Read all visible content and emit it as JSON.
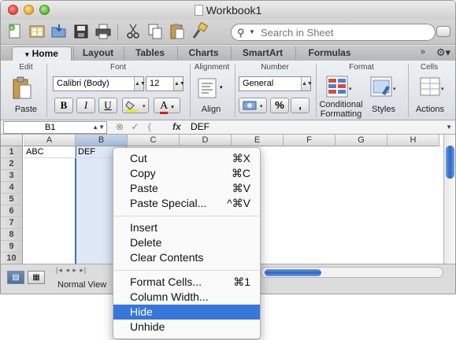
{
  "window": {
    "title": "Workbook1"
  },
  "toolbar": {
    "search_placeholder": "Search in Sheet"
  },
  "tabs": [
    "Home",
    "Layout",
    "Tables",
    "Charts",
    "SmartArt",
    "Formulas"
  ],
  "ribbon": {
    "groups": {
      "edit": "Edit",
      "font": "Font",
      "alignment": "Alignment",
      "number": "Number",
      "format": "Format",
      "cells": "Cells"
    },
    "paste_label": "Paste",
    "font_name": "Calibri (Body)",
    "font_size": "12",
    "bold": "B",
    "italic": "I",
    "underline": "U",
    "font_color_glyph": "A",
    "align_label": "Align",
    "number_format": "General",
    "percent": "%",
    "comma": ",",
    "conditional_formatting": [
      "Conditional",
      "Formatting"
    ],
    "styles_label": "Styles",
    "actions_label": "Actions"
  },
  "formula_bar": {
    "name_box": "B1",
    "fx": "fx",
    "content": "DEF"
  },
  "grid": {
    "columns": [
      "A",
      "B",
      "C",
      "D",
      "E",
      "F",
      "G",
      "H"
    ],
    "rows": [
      "1",
      "2",
      "3",
      "4",
      "5",
      "6",
      "7",
      "8",
      "9",
      "10"
    ],
    "cells": {
      "A1": "ABC",
      "B1": "DEF"
    }
  },
  "bottom": {
    "view_label": "Normal View",
    "sheet_nav": "|◂ ◂ ▸ ▸|"
  },
  "context_menu": {
    "groups": [
      [
        {
          "label": "Cut",
          "shortcut": "⌘X"
        },
        {
          "label": "Copy",
          "shortcut": "⌘C"
        },
        {
          "label": "Paste",
          "shortcut": "⌘V"
        },
        {
          "label": "Paste Special...",
          "shortcut": "^⌘V"
        }
      ],
      [
        {
          "label": "Insert",
          "shortcut": ""
        },
        {
          "label": "Delete",
          "shortcut": ""
        },
        {
          "label": "Clear Contents",
          "shortcut": ""
        }
      ],
      [
        {
          "label": "Format Cells...",
          "shortcut": "⌘1"
        },
        {
          "label": "Column Width...",
          "shortcut": ""
        },
        {
          "label": "Hide",
          "shortcut": ""
        },
        {
          "label": "Unhide",
          "shortcut": ""
        }
      ]
    ],
    "highlighted": "Hide"
  }
}
